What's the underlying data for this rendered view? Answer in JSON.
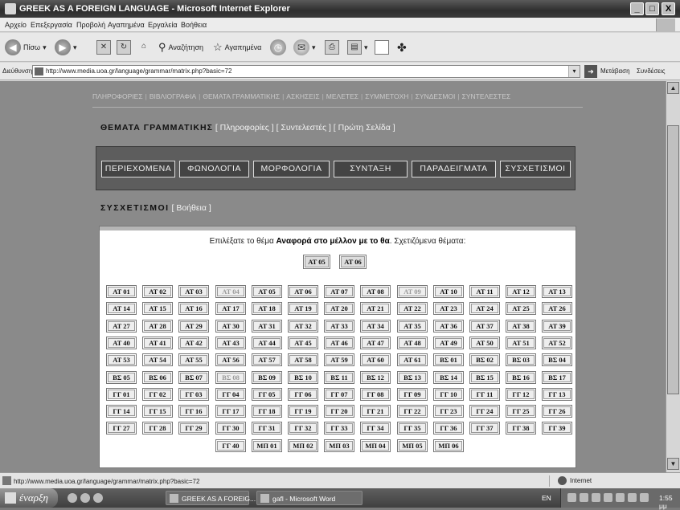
{
  "window": {
    "title": "GREEK AS A FOREIGN LANGUAGE - Microsoft Internet Explorer",
    "minimize": "_",
    "maximize": "□",
    "close": "X"
  },
  "menu": [
    "Αρχείο",
    "Επεξεργασία",
    "Προβολή",
    "Αγαπημένα",
    "Εργαλεία",
    "Βοήθεια"
  ],
  "toolbar": {
    "back": "Πίσω",
    "search": "Αναζήτηση",
    "favorites": "Αγαπημένα"
  },
  "address": {
    "label": "Διεύθυνση",
    "url": "http://www.media.uoa.gr/language/grammar/matrix.php?basic=72",
    "go": "Μετάβαση",
    "links": "Συνδέσεις"
  },
  "page": {
    "topnav": [
      "ΠΛΗΡΟΦΟΡΙΕΣ",
      "ΒΙΒΛΙΟΓΡΑΦΙΑ",
      "ΘΕΜΑΤΑ ΓΡΑΜΜΑΤΙΚΗΣ",
      "ΑΣΚΗΣΕΙΣ",
      "ΜΕΛΕΤΕΣ",
      "ΣΥΜΜΕΤΟΧΗ",
      "ΣΥΝΔΕΣΜΟΙ",
      "ΣΥΝΤΕΛΕΣΤΕΣ"
    ],
    "grammar_heading": "ΘΕΜΑΤΑ ΓΡΑΜΜΑΤΙΚΗΣ",
    "grammar_links": "[ Πληροφορίες ] [ Συντελεστές ] [ Πρώτη Σελίδα ]",
    "tabs": [
      "ΠΕΡΙΕΧΟΜΕΝΑ",
      "ΦΩΝΟΛΟΓΙΑ",
      "ΜΟΡΦΟΛΟΓΙΑ",
      "ΣΥΝΤΑΞΗ",
      "ΠΑΡΑΔΕΙΓΜΑΤΑ",
      "ΣΥΣΧΕΤΙΣΜΟΙ"
    ],
    "section_heading": "ΣΥΣΧΕΤΙΣΜΟΙ",
    "section_link": "[ Βοήθεια ]",
    "select_prefix": "Επιλέξατε το θέμα ",
    "select_topic": "Αναφορά στο μέλλον με το θα",
    "select_suffix": ". Σχετιζόμενα θέματα:",
    "related": [
      "ΑΤ 05",
      "ΑΤ 06"
    ],
    "grid": [
      [
        "ΑΤ 01",
        "ΑΤ 02",
        "ΑΤ 03",
        "ΑΤ 04",
        "ΑΤ 05",
        "ΑΤ 06",
        "ΑΤ 07",
        "ΑΤ 08",
        "ΑΤ 09",
        "ΑΤ 10",
        "ΑΤ 11",
        "ΑΤ 12",
        "ΑΤ 13"
      ],
      [
        "ΑΤ 14",
        "ΑΤ 15",
        "ΑΤ 16",
        "ΑΤ 17",
        "ΑΤ 18",
        "ΑΤ 19",
        "ΑΤ 20",
        "ΑΤ 21",
        "ΑΤ 22",
        "ΑΤ 23",
        "ΑΤ 24",
        "ΑΤ 25",
        "ΑΤ 26"
      ],
      [
        "ΑΤ 27",
        "ΑΤ 28",
        "ΑΤ 29",
        "ΑΤ 30",
        "ΑΤ 31",
        "ΑΤ 32",
        "ΑΤ 33",
        "ΑΤ 34",
        "ΑΤ 35",
        "ΑΤ 36",
        "ΑΤ 37",
        "ΑΤ 38",
        "ΑΤ 39"
      ],
      [
        "ΑΤ 40",
        "ΑΤ 41",
        "ΑΤ 42",
        "ΑΤ 43",
        "ΑΤ 44",
        "ΑΤ 45",
        "ΑΤ 46",
        "ΑΤ 47",
        "ΑΤ 48",
        "ΑΤ 49",
        "ΑΤ 50",
        "ΑΤ 51",
        "ΑΤ 52"
      ],
      [
        "ΑΤ 53",
        "ΑΤ 54",
        "ΑΤ 55",
        "ΑΤ 56",
        "ΑΤ 57",
        "ΑΤ 58",
        "ΑΤ 59",
        "ΑΤ 60",
        "ΑΤ 61",
        "ΒΣ 01",
        "ΒΣ 02",
        "ΒΣ 03",
        "ΒΣ 04"
      ],
      [
        "ΒΣ 05",
        "ΒΣ 06",
        "ΒΣ 07",
        "ΒΣ 08",
        "ΒΣ 09",
        "ΒΣ 10",
        "ΒΣ 11",
        "ΒΣ 12",
        "ΒΣ 13",
        "ΒΣ 14",
        "ΒΣ 15",
        "ΒΣ 16",
        "ΒΣ 17"
      ],
      [
        "ΓΓ 01",
        "ΓΓ 02",
        "ΓΓ 03",
        "ΓΓ 04",
        "ΓΓ 05",
        "ΓΓ 06",
        "ΓΓ 07",
        "ΓΓ 08",
        "ΓΓ 09",
        "ΓΓ 10",
        "ΓΓ 11",
        "ΓΓ 12",
        "ΓΓ 13"
      ],
      [
        "ΓΓ 14",
        "ΓΓ 15",
        "ΓΓ 16",
        "ΓΓ 17",
        "ΓΓ 18",
        "ΓΓ 19",
        "ΓΓ 20",
        "ΓΓ 21",
        "ΓΓ 22",
        "ΓΓ 23",
        "ΓΓ 24",
        "ΓΓ 25",
        "ΓΓ 26"
      ],
      [
        "ΓΓ 27",
        "ΓΓ 28",
        "ΓΓ 29",
        "ΓΓ 30",
        "ΓΓ 31",
        "ΓΓ 32",
        "ΓΓ 33",
        "ΓΓ 34",
        "ΓΓ 35",
        "ΓΓ 36",
        "ΓΓ 37",
        "ΓΓ 38",
        "ΓΓ 39"
      ],
      [
        "ΓΓ 40",
        "ΜΠ 01",
        "ΜΠ 02",
        "ΜΠ 03",
        "ΜΠ 04",
        "ΜΠ 05",
        "ΜΠ 06"
      ]
    ],
    "dimmed": [
      "ΑΤ 04",
      "ΑΤ 09",
      "ΒΣ 08"
    ]
  },
  "status": {
    "text": "http://www.media.uoa.gr/language/grammar/matrix.php?basic=72",
    "zone": "Internet"
  },
  "taskbar": {
    "start": "έναρξη",
    "tasks": [
      "GREEK AS A FOREIG...",
      "gafl - Microsoft Word"
    ],
    "lang": "EN",
    "time": "1:55 μμ"
  }
}
